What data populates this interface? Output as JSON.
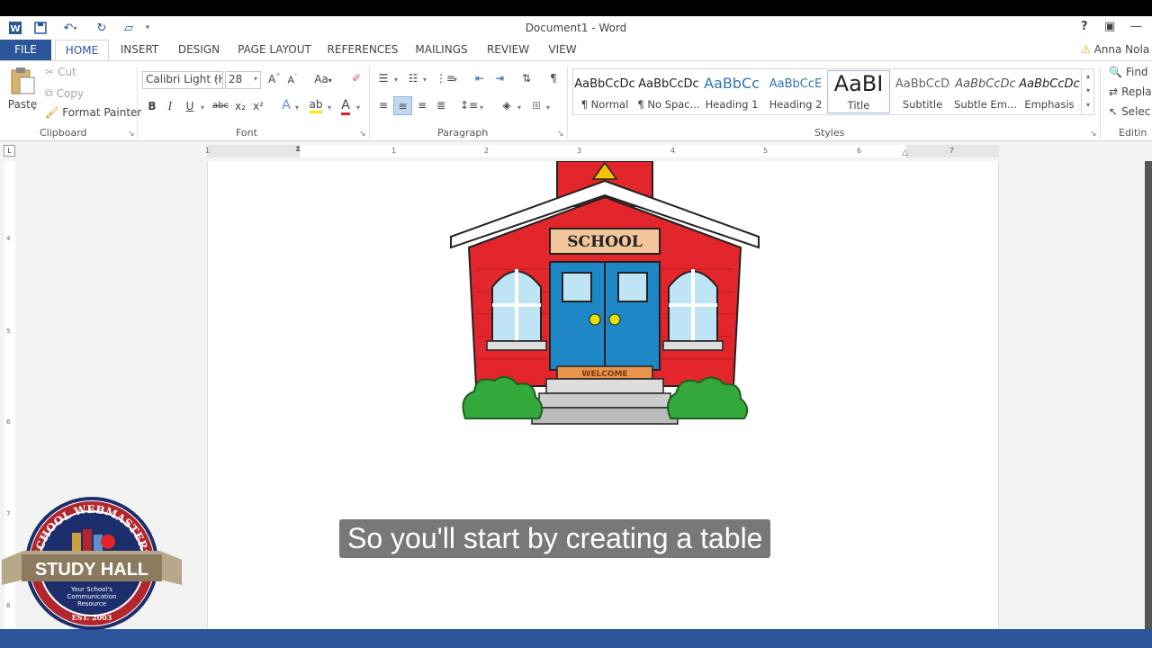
{
  "window": {
    "title": "Document1 - Word",
    "user": "Anna Nola",
    "help": "?"
  },
  "tabs": [
    "FILE",
    "HOME",
    "INSERT",
    "DESIGN",
    "PAGE LAYOUT",
    "REFERENCES",
    "MAILINGS",
    "REVIEW",
    "VIEW"
  ],
  "clipboard": {
    "paste": "Paste",
    "cut": "Cut",
    "copy": "Copy",
    "format_painter": "Format Painter",
    "label": "Clipboard"
  },
  "font": {
    "name": "Calibri Light (H",
    "size": "28",
    "change_case": "Aa",
    "bold": "B",
    "italic": "I",
    "underline": "U",
    "strike": "abc",
    "sub": "x₂",
    "sup": "x²",
    "label": "Font"
  },
  "paragraph": {
    "label": "Paragraph",
    "pilcrow": "¶"
  },
  "styles": {
    "label": "Styles",
    "items": [
      {
        "preview": "AaBbCcDc",
        "name": "¶ Normal"
      },
      {
        "preview": "AaBbCcDc",
        "name": "¶ No Spac..."
      },
      {
        "preview": "AaBbCc",
        "name": "Heading 1"
      },
      {
        "preview": "AaBbCcE",
        "name": "Heading 2"
      },
      {
        "preview": "AaBI",
        "name": "Title"
      },
      {
        "preview": "AaBbCcD",
        "name": "Subtitle"
      },
      {
        "preview": "AaBbCcDc",
        "name": "Subtle Em..."
      },
      {
        "preview": "AaBbCcDc",
        "name": "Emphasis"
      }
    ]
  },
  "editing": {
    "find": "Find",
    "replace": "Repla",
    "select": "Selec",
    "label": "Editin"
  },
  "ruler": {
    "marks": [
      "1",
      "1",
      "2",
      "3",
      "4",
      "5",
      "6",
      "7"
    ],
    "vmarks": [
      "4",
      "5",
      "6",
      "7",
      "8"
    ]
  },
  "image": {
    "sign": "SCHOOL",
    "mat": "WELCOME"
  },
  "caption": "So you'll start by creating a table",
  "logo": {
    "arc": "SCHOOL WEBMASTERS",
    "banner": "STUDY HALL",
    "tagline1": "Your School's",
    "tagline2": "Communication",
    "tagline3": "Resource",
    "est": "EST. 2003"
  },
  "colors": {
    "word_blue": "#2b579a",
    "school_red": "#e2262c",
    "door_blue": "#1e88c7"
  }
}
